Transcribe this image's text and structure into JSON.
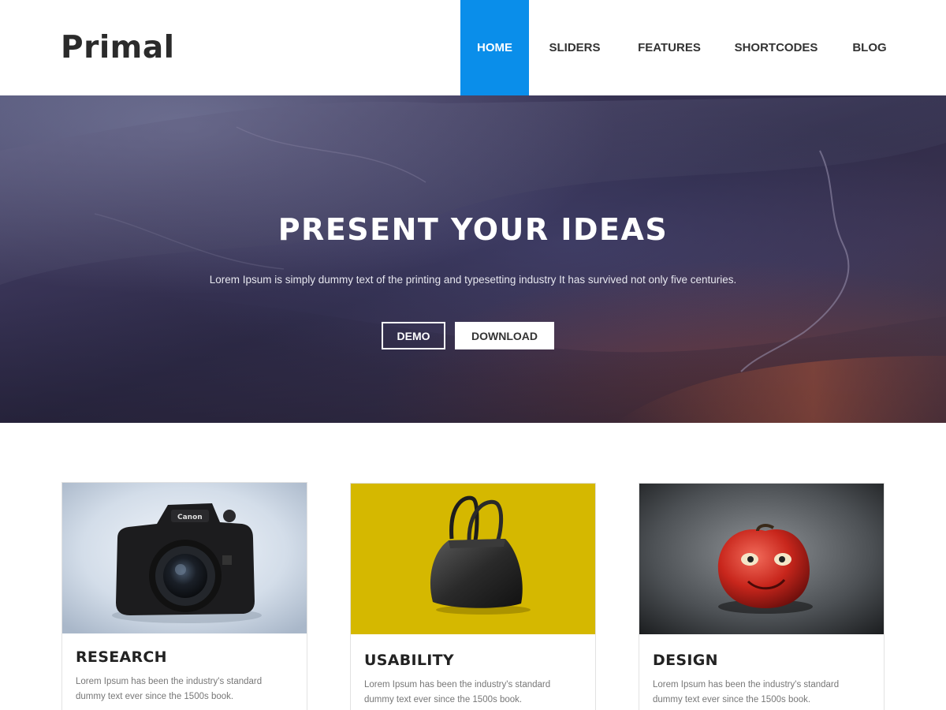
{
  "brand": {
    "logo_text": "Primal"
  },
  "nav": {
    "items": [
      {
        "label": "HOME",
        "active": true
      },
      {
        "label": "SLIDERS"
      },
      {
        "label": "FEATURES"
      },
      {
        "label": "SHORTCODES"
      },
      {
        "label": "BLOG"
      }
    ],
    "active_color": "#0a8eea"
  },
  "hero": {
    "title": "PRESENT YOUR IDEAS",
    "text": "Lorem Ipsum is simply dummy text of the printing and typesetting industry It has survived not only five centuries.",
    "demo_label": "DEMO",
    "download_label": "DOWNLOAD"
  },
  "cards": [
    {
      "title": "RESEARCH",
      "text": "Lorem Ipsum has been the industry's standard dummy text ever since the 1500s book.",
      "image": "camera-image"
    },
    {
      "title": "USABILITY",
      "text": "Lorem Ipsum has been the industry's standard dummy text ever since the 1500s book.",
      "image": "handbag-image"
    },
    {
      "title": "DESIGN",
      "text": "Lorem Ipsum has been the industry's standard dummy text ever since the 1500s book.",
      "image": "apple-face-image"
    }
  ]
}
